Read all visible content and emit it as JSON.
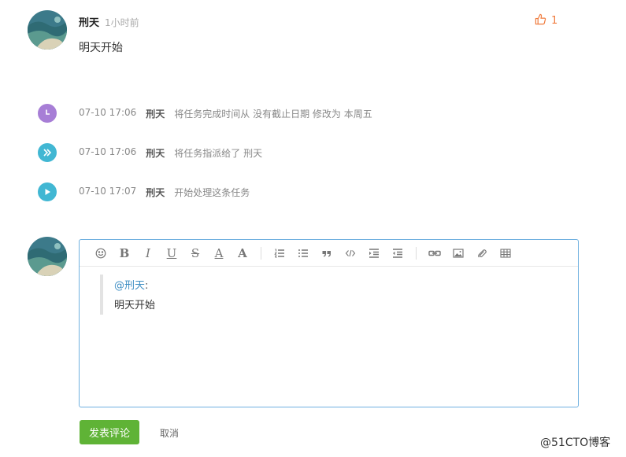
{
  "comment": {
    "author": "刑天",
    "time": "1小时前",
    "text": "明天开始",
    "likes": "1"
  },
  "activities": [
    {
      "time": "07-10 17:06",
      "user": "刑天",
      "action": "将任务完成时间从 没有截止日期 修改为 本周五",
      "icon": "clock-icon",
      "color": "#a77ed6"
    },
    {
      "time": "07-10 17:06",
      "user": "刑天",
      "action": "将任务指派给了 刑天",
      "icon": "double-chevron-icon",
      "color": "#41b7d3"
    },
    {
      "time": "07-10 17:07",
      "user": "刑天",
      "action": "开始处理这条任务",
      "icon": "play-icon",
      "color": "#41b7d3"
    }
  ],
  "editor": {
    "mention": "@刑天",
    "colon": ":",
    "quote_text": "明天开始"
  },
  "buttons": {
    "submit": "发表评论",
    "cancel": "取消"
  },
  "toolbar": {
    "bold": "B",
    "italic": "I",
    "underline": "U",
    "strike": "S",
    "font_color": "A",
    "font_size": "A"
  },
  "watermark": "@51CTO博客",
  "colors": {
    "accent_green": "#5fb336",
    "like_orange": "#f07c3e",
    "editor_border": "#6fb0e0",
    "mention_blue": "#3f8fc4"
  }
}
